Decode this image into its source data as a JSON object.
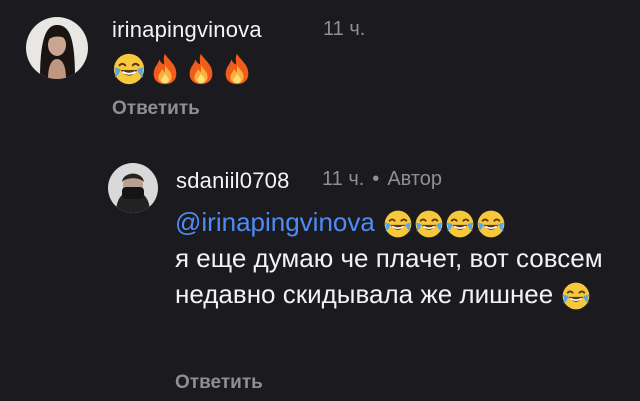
{
  "comment1": {
    "username": "irinapingvinova",
    "time": "11 ч.",
    "emojis": [
      "laughing-crying",
      "fire",
      "fire",
      "fire"
    ],
    "reply_label": "Ответить"
  },
  "comment2": {
    "username": "sdaniil0708",
    "time": "11 ч.",
    "separator": "•",
    "author_badge": "Автор",
    "mention": "@irinapingvinova",
    "mention_emojis": [
      "laughing-crying",
      "laughing-crying",
      "laughing-crying",
      "laughing-crying"
    ],
    "text": "я еще думаю че плачет, вот совсем недавно скидывала же лишнее",
    "trailing_emoji": "laughing-crying",
    "reply_label": "Ответить"
  },
  "colors": {
    "background": "#1b1b1f",
    "mention": "#4e8cf5",
    "secondary_text": "#8e8e93"
  }
}
